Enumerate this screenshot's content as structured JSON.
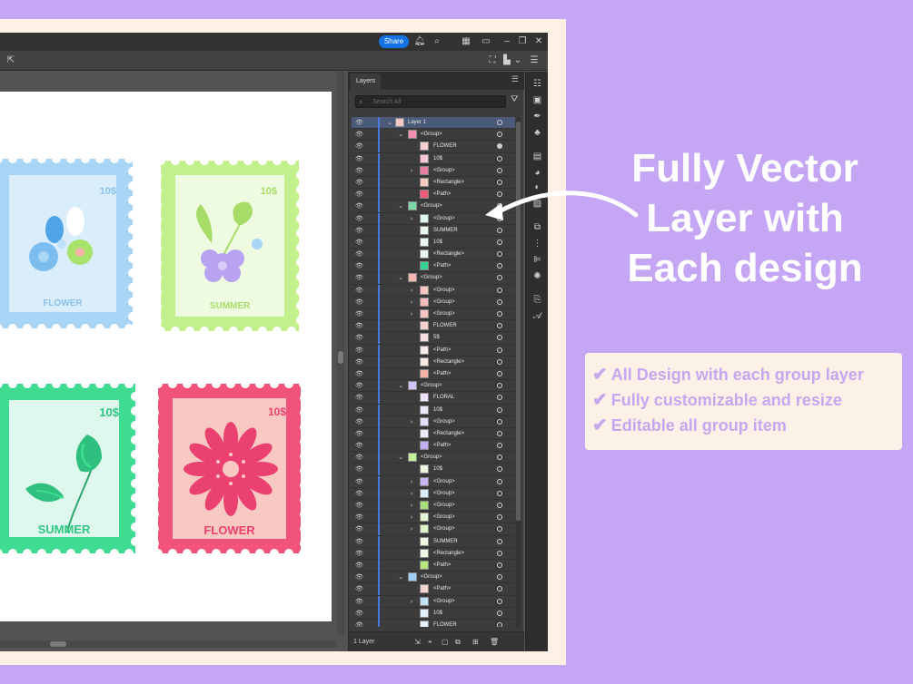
{
  "app": {
    "share_label": "Share"
  },
  "layers_panel": {
    "tab_label": "Layers",
    "search_placeholder": "Search All",
    "footer_label": "1 Layer",
    "rows": [
      {
        "label": "Layer 1",
        "indent": 0,
        "chevron": "down",
        "thumb": "#f6c7c7"
      },
      {
        "label": "<Group>",
        "indent": 1,
        "chevron": "down",
        "thumb": "#f58fb0"
      },
      {
        "label": "FLOWER",
        "indent": 2,
        "chevron": "",
        "thumb": "#f4d0d0"
      },
      {
        "label": "10$",
        "indent": 2,
        "chevron": "",
        "thumb": "#f9c5d5"
      },
      {
        "label": "<Group>",
        "indent": 2,
        "chevron": "right",
        "thumb": "#e87fa1"
      },
      {
        "label": "<Rectangle>",
        "indent": 2,
        "chevron": "",
        "thumb": "#f7c8c0"
      },
      {
        "label": "<Path>",
        "indent": 2,
        "chevron": "",
        "thumb": "#ef5d7a"
      },
      {
        "label": "<Group>",
        "indent": 1,
        "chevron": "down",
        "thumb": "#7bd9a7"
      },
      {
        "label": "<Group>",
        "indent": 2,
        "chevron": "right",
        "thumb": "#dff8ec"
      },
      {
        "label": "SUMMER",
        "indent": 2,
        "chevron": "",
        "thumb": "#e7f9ef"
      },
      {
        "label": "10$",
        "indent": 2,
        "chevron": "",
        "thumb": "#e9f9f2"
      },
      {
        "label": "<Rectangle>",
        "indent": 2,
        "chevron": "",
        "thumb": "#e6f8ef"
      },
      {
        "label": "<Path>",
        "indent": 2,
        "chevron": "",
        "thumb": "#3ad393"
      },
      {
        "label": "<Group>",
        "indent": 1,
        "chevron": "down",
        "thumb": "#f3b6b0"
      },
      {
        "label": "<Group>",
        "indent": 2,
        "chevron": "right",
        "thumb": "#f8c6c0"
      },
      {
        "label": "<Group>",
        "indent": 2,
        "chevron": "right",
        "thumb": "#f6bcbc"
      },
      {
        "label": "<Group>",
        "indent": 2,
        "chevron": "right",
        "thumb": "#f7c4c1"
      },
      {
        "label": "FLOWER",
        "indent": 2,
        "chevron": "",
        "thumb": "#f5d2d0"
      },
      {
        "label": "5$",
        "indent": 2,
        "chevron": "",
        "thumb": "#f9e0e0"
      },
      {
        "label": "<Path>",
        "indent": 2,
        "chevron": "",
        "thumb": "#fbeaea"
      },
      {
        "label": "<Rectangle>",
        "indent": 2,
        "chevron": "",
        "thumb": "#fbe9e6"
      },
      {
        "label": "<Path>",
        "indent": 2,
        "chevron": "",
        "thumb": "#f4b2a8"
      },
      {
        "label": "<Group>",
        "indent": 1,
        "chevron": "down",
        "thumb": "#d3c2f5"
      },
      {
        "label": "FLORAL",
        "indent": 2,
        "chevron": "",
        "thumb": "#ece4fb"
      },
      {
        "label": "10$",
        "indent": 2,
        "chevron": "",
        "thumb": "#eee8fb"
      },
      {
        "label": "<Group>",
        "indent": 2,
        "chevron": "right",
        "thumb": "#e6dcfb"
      },
      {
        "label": "<Rectangle>",
        "indent": 2,
        "chevron": "",
        "thumb": "#efe9fc"
      },
      {
        "label": "<Path>",
        "indent": 2,
        "chevron": "",
        "thumb": "#c2aef3"
      },
      {
        "label": "<Group>",
        "indent": 1,
        "chevron": "down",
        "thumb": "#c9ee9a"
      },
      {
        "label": "10$",
        "indent": 2,
        "chevron": "",
        "thumb": "#eaf7dc"
      },
      {
        "label": "<Group>",
        "indent": 2,
        "chevron": "right",
        "thumb": "#c7b8f5"
      },
      {
        "label": "<Group>",
        "indent": 2,
        "chevron": "right",
        "thumb": "#d5effa"
      },
      {
        "label": "<Group>",
        "indent": 2,
        "chevron": "right",
        "thumb": "#a6e07a"
      },
      {
        "label": "<Group>",
        "indent": 2,
        "chevron": "right",
        "thumb": "#e5f6d4"
      },
      {
        "label": "<Group>",
        "indent": 2,
        "chevron": "right",
        "thumb": "#dff3c8"
      },
      {
        "label": "SUMMER",
        "indent": 2,
        "chevron": "",
        "thumb": "#edf8e1"
      },
      {
        "label": "<Rectangle>",
        "indent": 2,
        "chevron": "",
        "thumb": "#eef9e4"
      },
      {
        "label": "<Path>",
        "indent": 2,
        "chevron": "",
        "thumb": "#b6e77c"
      },
      {
        "label": "<Group>",
        "indent": 1,
        "chevron": "down",
        "thumb": "#9fd0f2"
      },
      {
        "label": "<Path>",
        "indent": 2,
        "chevron": "",
        "thumb": "#f2d3cf"
      },
      {
        "label": "<Group>",
        "indent": 2,
        "chevron": "right",
        "thumb": "#bfe2f7"
      },
      {
        "label": "10$",
        "indent": 2,
        "chevron": "",
        "thumb": "#e1f1fb"
      },
      {
        "label": "FLOWER",
        "indent": 2,
        "chevron": "",
        "thumb": "#e6f3fb"
      }
    ]
  },
  "stamps": [
    {
      "price": "10$",
      "label": "FLOWER",
      "border": "#a8d4f5",
      "inner": "#d9edfb",
      "text": "#8dc3ea"
    },
    {
      "price": "10$",
      "label": "SUMMER",
      "border": "#c2f08c",
      "inner": "#eefbe0",
      "text": "#a8dc69"
    },
    {
      "price": "10$",
      "label": "SUMMER",
      "border": "#3ddc91",
      "inner": "#dff8ee",
      "text": "#2fc783"
    },
    {
      "price": "10$",
      "label": "FLOWER",
      "border": "#f0527a",
      "inner": "#f8c9c3",
      "text": "#ea4170"
    }
  ],
  "promo": {
    "heading_line1": "Fully Vector",
    "heading_line2": "Layer with",
    "heading_line3": "Each design",
    "features": [
      "All Design with each group layer",
      "Fully customizable and resize",
      "Editable all group item"
    ],
    "check_glyph": "✔"
  },
  "colors": {
    "background": "#c4a6f4",
    "frame": "#fdf0e4",
    "accent_blue": "#1473e6",
    "feature_text": "#c7a6f0"
  }
}
